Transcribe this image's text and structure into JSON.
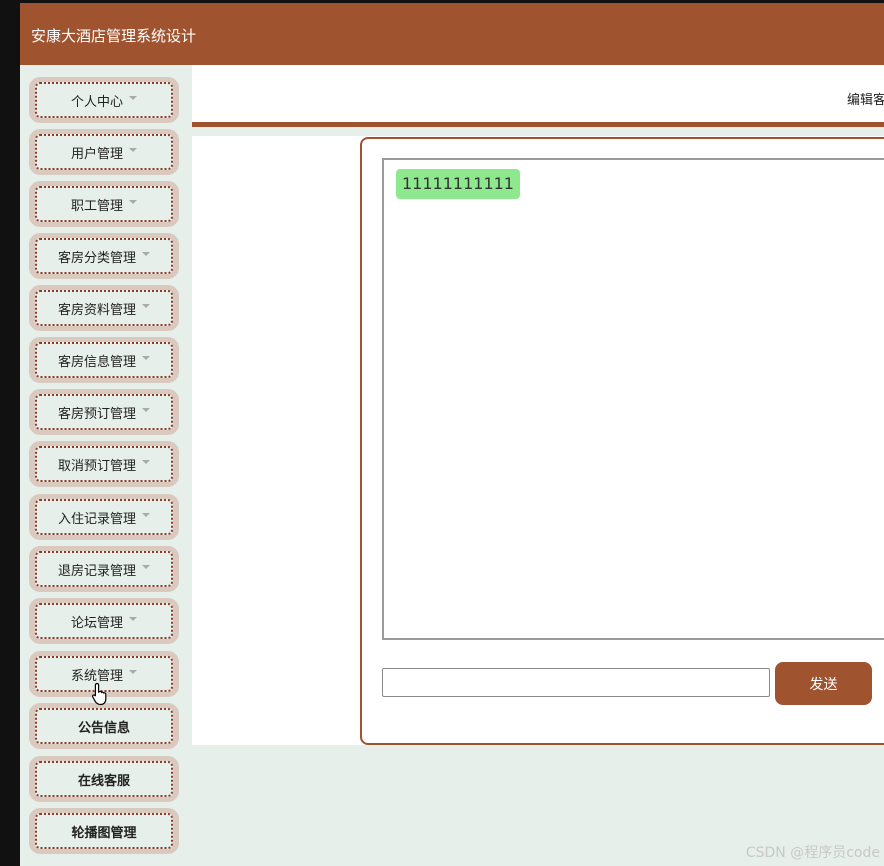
{
  "app": {
    "title": "安康大酒店管理系统设计"
  },
  "sidebar": {
    "items": [
      {
        "label": "个人中心",
        "has_caret": true,
        "bold": false
      },
      {
        "label": "用户管理",
        "has_caret": true,
        "bold": false
      },
      {
        "label": "职工管理",
        "has_caret": true,
        "bold": false
      },
      {
        "label": "客房分类管理",
        "has_caret": true,
        "bold": false
      },
      {
        "label": "客房资料管理",
        "has_caret": true,
        "bold": false
      },
      {
        "label": "客房信息管理",
        "has_caret": true,
        "bold": false
      },
      {
        "label": "客房预订管理",
        "has_caret": true,
        "bold": false
      },
      {
        "label": "取消预订管理",
        "has_caret": true,
        "bold": false
      },
      {
        "label": "入住记录管理",
        "has_caret": true,
        "bold": false
      },
      {
        "label": "退房记录管理",
        "has_caret": true,
        "bold": false
      },
      {
        "label": "论坛管理",
        "has_caret": true,
        "bold": false
      },
      {
        "label": "系统管理",
        "has_caret": true,
        "bold": false
      },
      {
        "label": "公告信息",
        "has_caret": false,
        "bold": true
      },
      {
        "label": "在线客服",
        "has_caret": false,
        "bold": true
      },
      {
        "label": "轮播图管理",
        "has_caret": false,
        "bold": true
      }
    ]
  },
  "topbar": {
    "breadcrumb": "编辑客"
  },
  "chat": {
    "messages": [
      {
        "text": "11111111111"
      }
    ],
    "input_value": "",
    "send_label": "发送"
  },
  "watermark": "CSDN @程序员code",
  "colors": {
    "brand": "#a0532f",
    "sidebar_bg": "#e6efe9",
    "bubble": "#8ee88e"
  }
}
